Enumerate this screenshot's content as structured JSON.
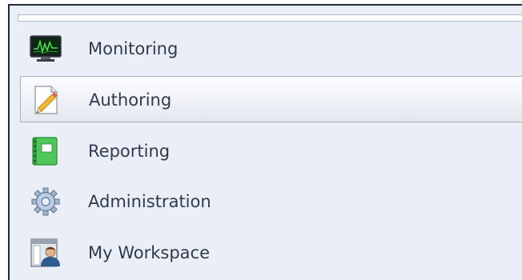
{
  "nav": {
    "items": [
      {
        "label": "Monitoring",
        "icon": "monitor-icon",
        "selected": false
      },
      {
        "label": "Authoring",
        "icon": "pencil-document-icon",
        "selected": true
      },
      {
        "label": "Reporting",
        "icon": "report-book-icon",
        "selected": false
      },
      {
        "label": "Administration",
        "icon": "gear-icon",
        "selected": false
      },
      {
        "label": "My Workspace",
        "icon": "user-workspace-icon",
        "selected": false
      }
    ]
  },
  "colors": {
    "panel_background": "#eaeef7",
    "text": "#2f3a4d",
    "selected_border": "#aab0bb",
    "panel_border": "#1f2b3d"
  }
}
